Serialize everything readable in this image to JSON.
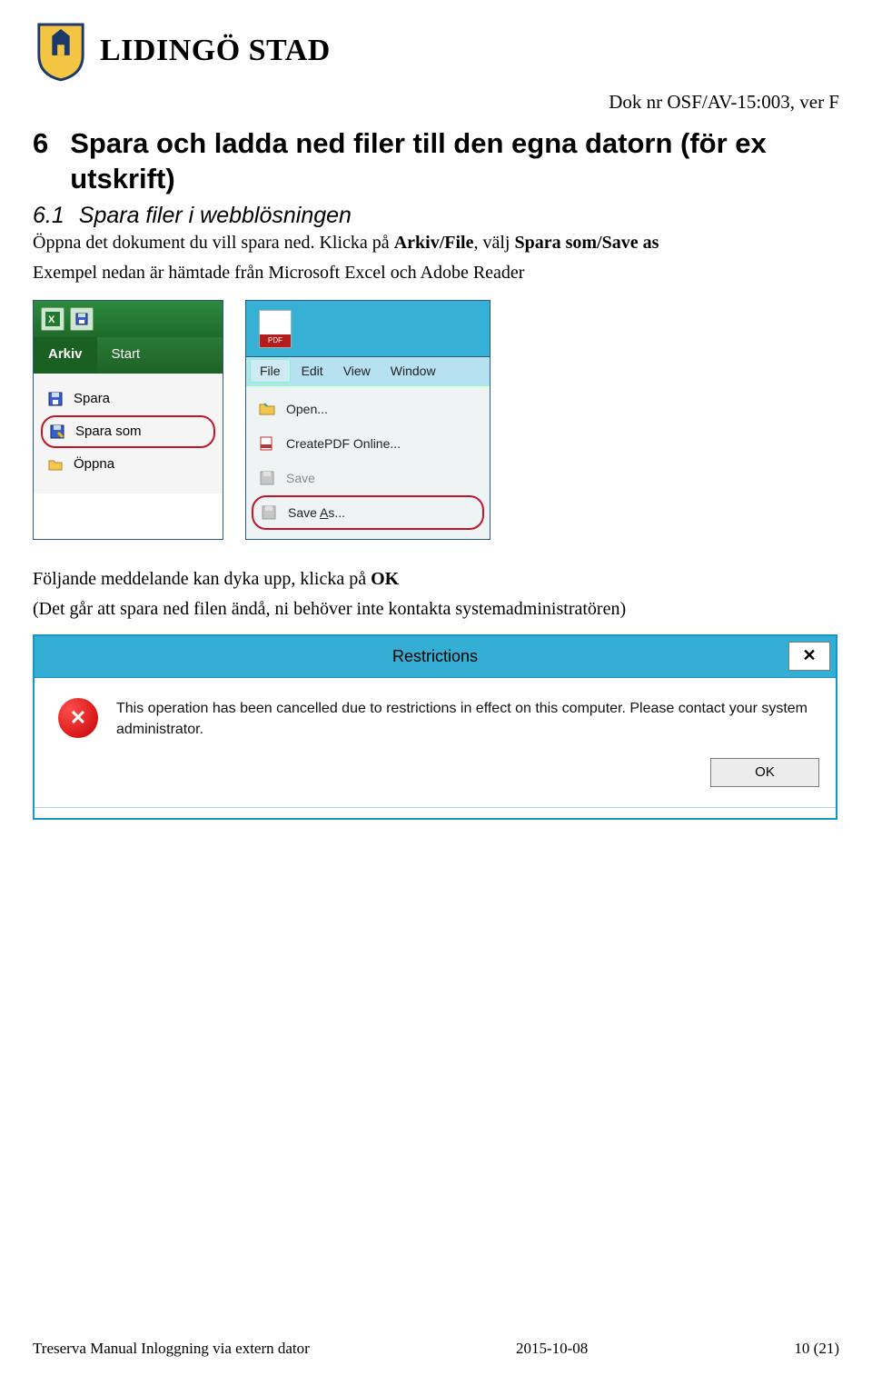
{
  "header": {
    "brand": "LIDINGÖ STAD",
    "doc_ref": "Dok nr OSF/AV-15:003, ver F"
  },
  "section": {
    "number": "6",
    "title": "Spara och ladda ned filer till den egna datorn (för ex utskrift)"
  },
  "subsection": {
    "number": "6.1",
    "title": "Spara filer i webblösningen"
  },
  "para1": {
    "pre": "Öppna det dokument du vill spara ned. Klicka på ",
    "b1": "Arkiv/File",
    "mid": ", välj ",
    "b2": "Spara som/Save as"
  },
  "para2": "Exempel nedan är hämtade från Microsoft Excel och Adobe Reader",
  "excel": {
    "tab_arkiv": "Arkiv",
    "tab_start": "Start",
    "item_spara": "Spara",
    "item_spara_som": "Spara som",
    "item_oppna": "Öppna"
  },
  "reader": {
    "menu_file": "File",
    "menu_edit": "Edit",
    "menu_view": "View",
    "menu_window": "Window",
    "item_open": "Open...",
    "item_createpdf": "CreatePDF Online...",
    "item_save": "Save",
    "item_saveas_pre": "Save ",
    "item_saveas_u": "A",
    "item_saveas_post": "s...",
    "pdf_label": "PDF"
  },
  "para3": {
    "line1_pre": "Följande meddelande kan dyka upp, klicka på ",
    "line1_b": "OK",
    "line2": "(Det går att spara ned filen ändå, ni behöver inte kontakta systemadministratören)"
  },
  "dialog": {
    "title": "Restrictions",
    "close": "✕",
    "error_glyph": "✕",
    "message": "This operation has been cancelled due to restrictions in effect on this computer. Please contact your system administrator.",
    "ok": "OK"
  },
  "footer": {
    "left": "Treserva Manual Inloggning via extern dator",
    "center": "2015-10-08",
    "right": "10 (21)"
  }
}
